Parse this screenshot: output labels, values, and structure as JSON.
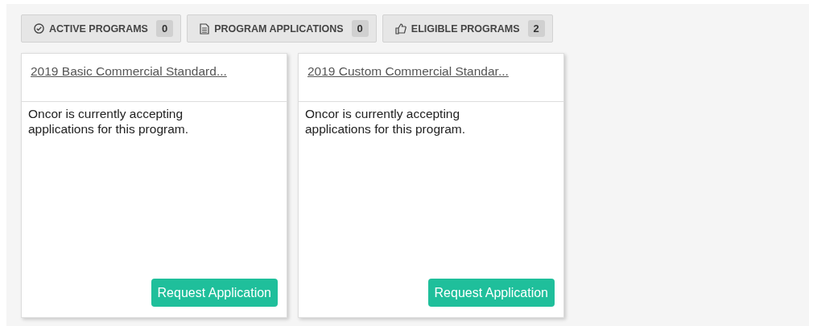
{
  "tabs": [
    {
      "kind": "active",
      "label": "ACTIVE PROGRAMS",
      "count": "0"
    },
    {
      "kind": "applications",
      "label": "PROGRAM APPLICATIONS",
      "count": "0"
    },
    {
      "kind": "eligible",
      "label": "ELIGIBLE PROGRAMS",
      "count": "2"
    }
  ],
  "cards": [
    {
      "title": "2019 Basic Commercial Standard...",
      "description": "Oncor is currently accepting applications for this program.",
      "button": "Request Application"
    },
    {
      "title": "2019 Custom Commercial Standar...",
      "description": "Oncor is currently accepting applications for this program.",
      "button": "Request Application"
    }
  ]
}
